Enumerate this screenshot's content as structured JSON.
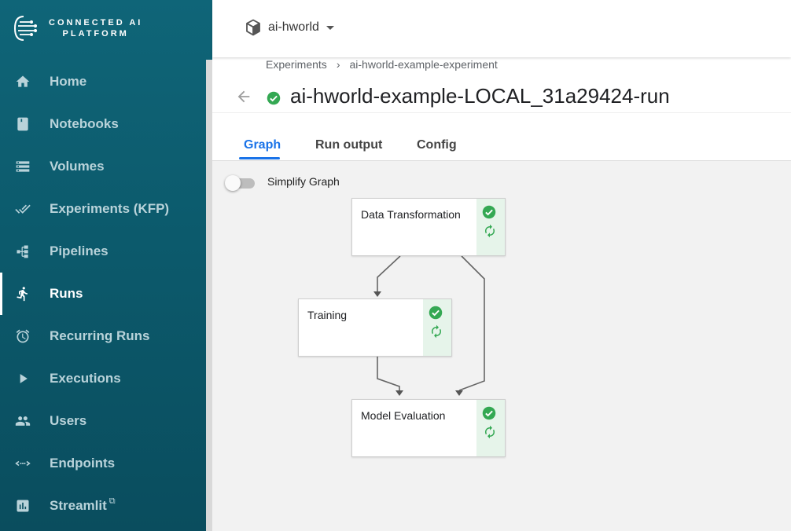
{
  "app": {
    "logo_line1": "CONNECTED AI",
    "logo_line2": "PLATFORM"
  },
  "sidebar": {
    "items": [
      {
        "label": "Home",
        "icon": "home-icon"
      },
      {
        "label": "Notebooks",
        "icon": "notebook-icon"
      },
      {
        "label": "Volumes",
        "icon": "volumes-icon"
      },
      {
        "label": "Experiments (KFP)",
        "icon": "double-check-icon"
      },
      {
        "label": "Pipelines",
        "icon": "pipeline-icon"
      },
      {
        "label": "Runs",
        "icon": "run-icon",
        "active": true
      },
      {
        "label": "Recurring Runs",
        "icon": "alarm-icon"
      },
      {
        "label": "Executions",
        "icon": "play-icon"
      },
      {
        "label": "Users",
        "icon": "users-icon"
      },
      {
        "label": "Endpoints",
        "icon": "endpoints-icon"
      },
      {
        "label": "Streamlit",
        "icon": "chart-icon",
        "external": "external-link-icon"
      }
    ]
  },
  "topbar": {
    "namespace": "ai-hworld"
  },
  "breadcrumb": {
    "items": [
      "Experiments",
      "ai-hworld-example-experiment"
    ],
    "separator": "›"
  },
  "run": {
    "title": "ai-hworld-example-LOCAL_31a29424-run",
    "status": "succeeded",
    "status_color": "#34a853"
  },
  "tabs": [
    {
      "label": "Graph",
      "active": true
    },
    {
      "label": "Run output",
      "active": false
    },
    {
      "label": "Config",
      "active": false
    }
  ],
  "graph": {
    "simplify_label": "Simplify Graph",
    "simplify_enabled": false,
    "nodes": [
      {
        "name": "Data Transformation",
        "status": "succeeded"
      },
      {
        "name": "Training",
        "status": "succeeded"
      },
      {
        "name": "Model Evaluation",
        "status": "succeeded"
      }
    ],
    "edges": [
      [
        "Data Transformation",
        "Training"
      ],
      [
        "Data Transformation",
        "Model Evaluation"
      ],
      [
        "Training",
        "Model Evaluation"
      ]
    ]
  },
  "colors": {
    "sidebar_bg": "#0c5a6c",
    "accent": "#1a73e8",
    "success": "#34a853"
  }
}
